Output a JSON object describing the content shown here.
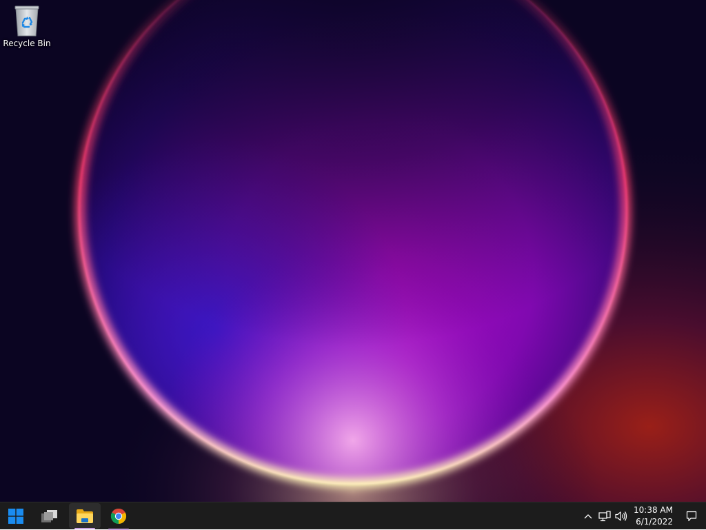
{
  "desktop": {
    "icons": [
      {
        "label": "Recycle Bin",
        "icon": "recycle-bin-icon"
      }
    ]
  },
  "taskbar": {
    "start": {
      "icon": "windows-start-icon"
    },
    "task_view": {
      "icon": "task-view-icon"
    },
    "apps": [
      {
        "name": "File Explorer",
        "icon": "file-explorer-icon",
        "active": true
      },
      {
        "name": "Google Chrome",
        "icon": "chrome-icon",
        "active": false
      }
    ],
    "tray": {
      "overflow_icon": "chevron-up-icon",
      "network_icon": "network-icon",
      "volume_icon": "volume-icon",
      "notification_icon": "notification-icon"
    },
    "clock": {
      "time": "10:38 AM",
      "date": "6/1/2022"
    }
  },
  "colors": {
    "taskbar_bg": "#1c1c1c",
    "accent_indicator": "#c7a3e0",
    "windows_blue": "#0078d4"
  }
}
